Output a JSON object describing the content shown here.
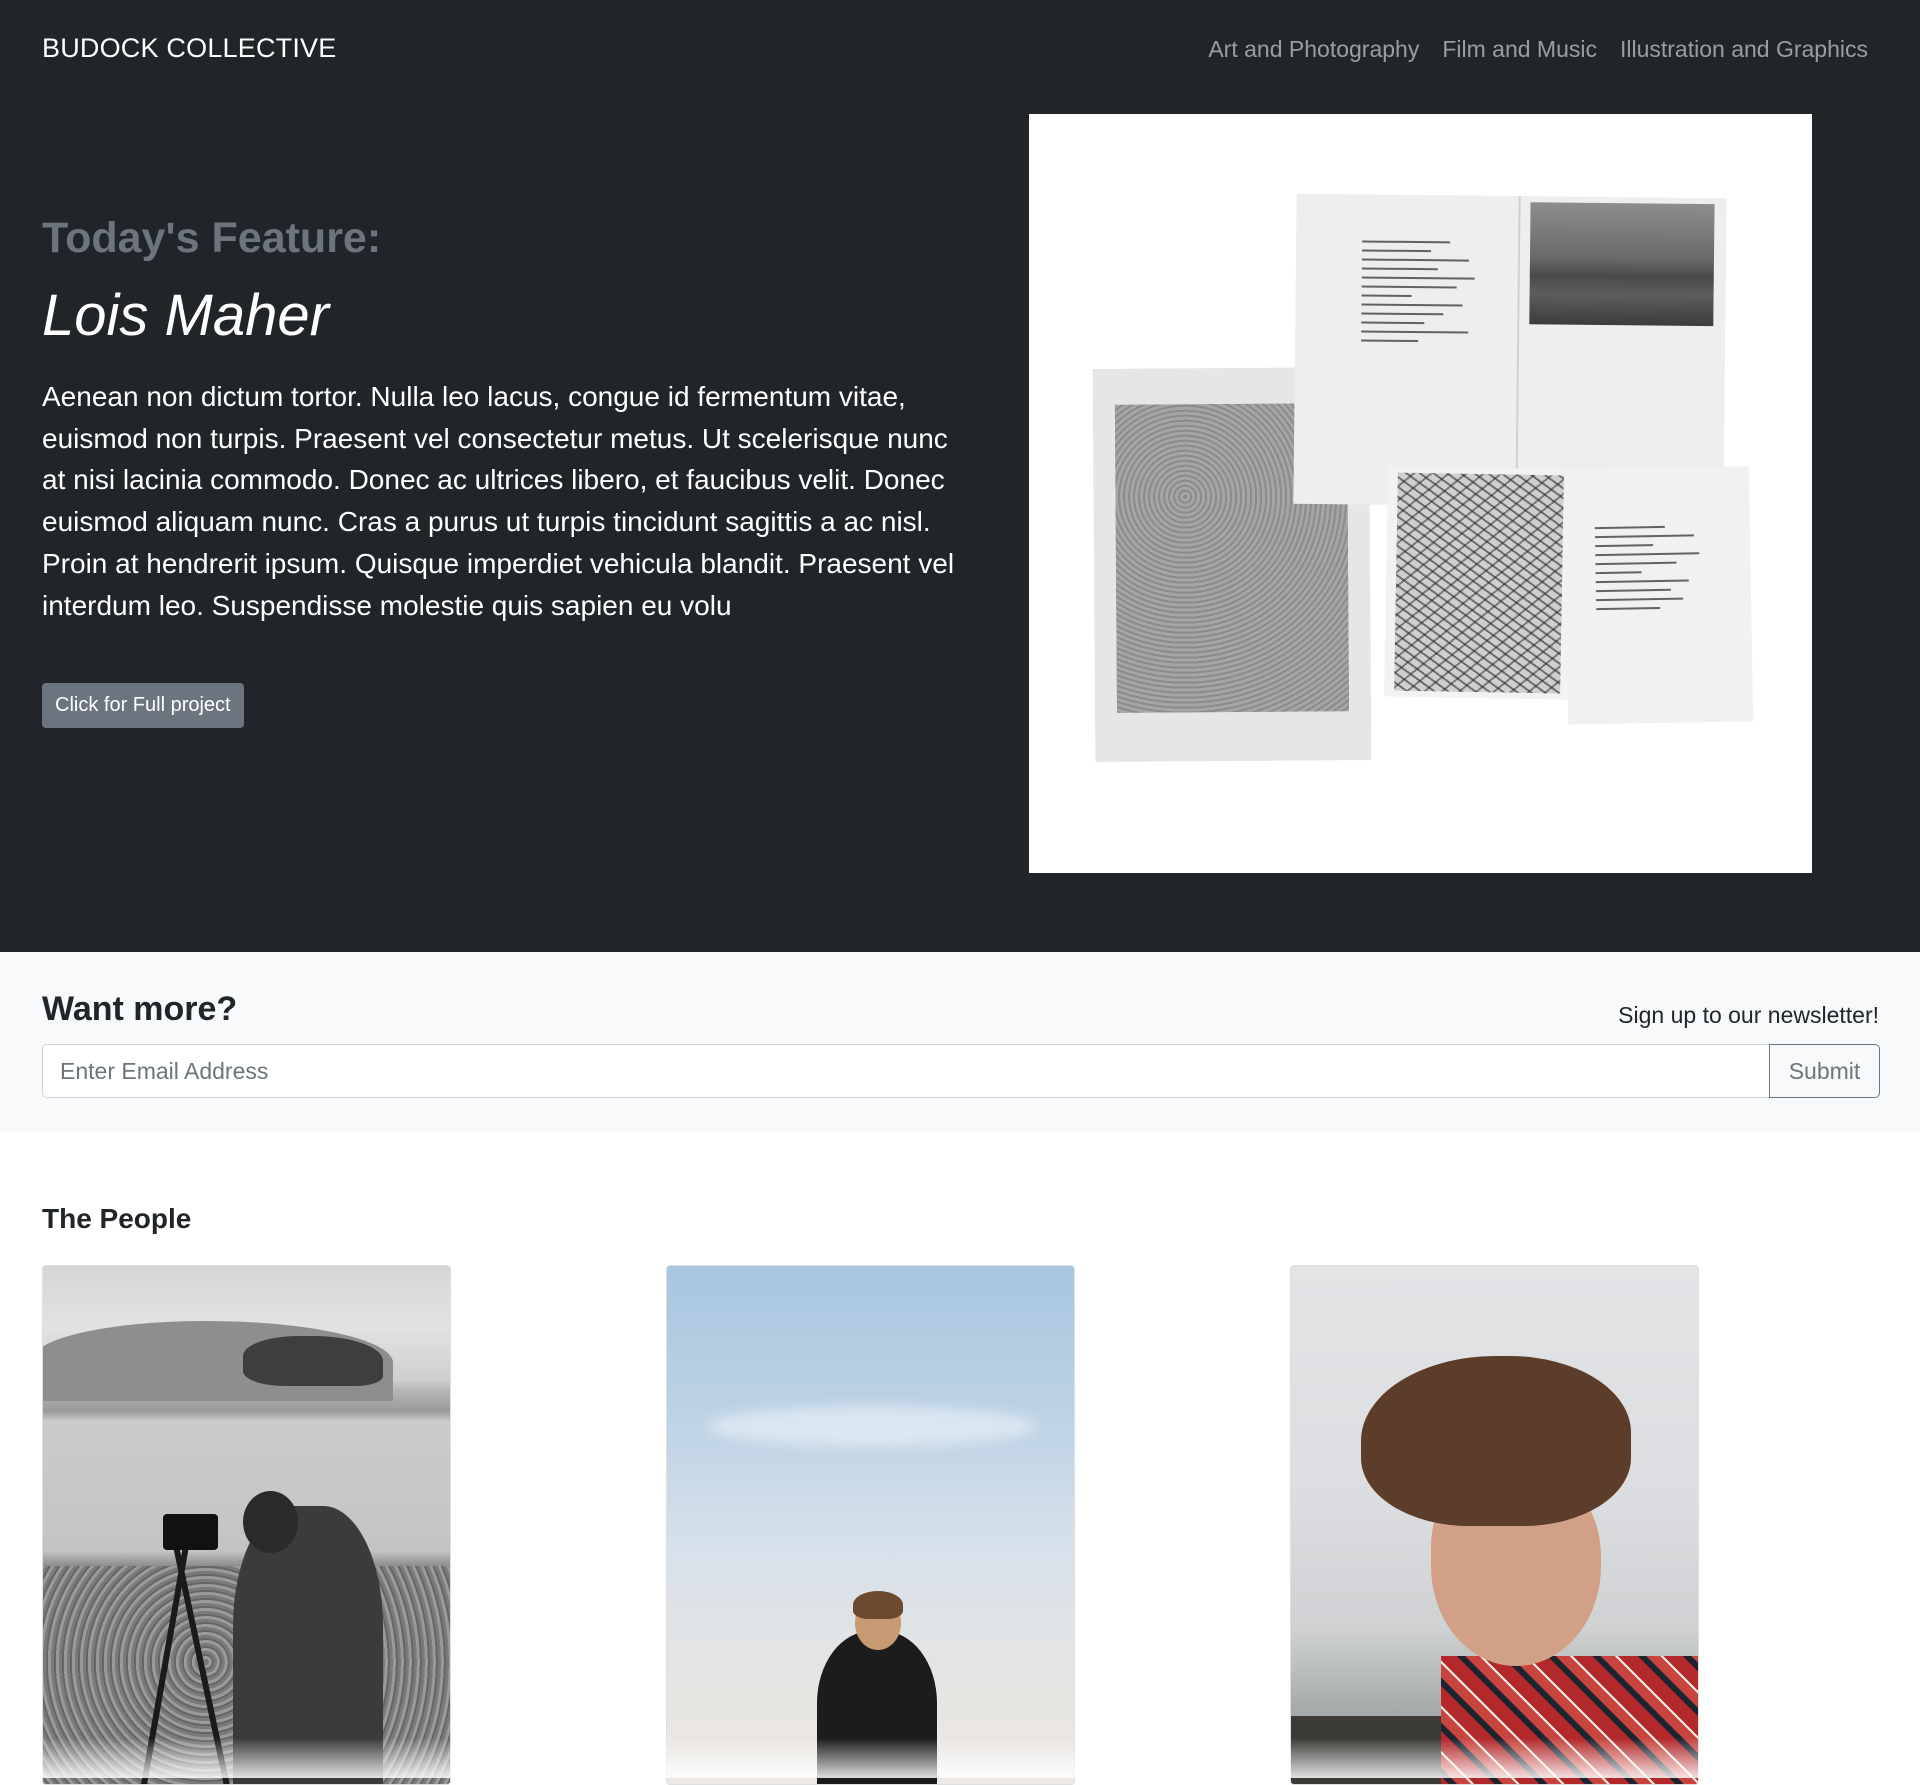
{
  "header": {
    "brand": "BUDOCK COLLECTIVE",
    "nav": [
      {
        "label": "Art and Photography"
      },
      {
        "label": "Film and Music"
      },
      {
        "label": "Illustration and Graphics"
      }
    ]
  },
  "feature": {
    "kicker": "Today's Feature:",
    "name": "Lois Maher",
    "body": "Aenean non dictum tortor. Nulla leo lacus, congue id fermentum vitae, euismod non turpis. Praesent vel consectetur metus. Ut scelerisque nunc at nisi lacinia commodo. Donec ac ultrices libero, et faucibus velit. Donec euismod aliquam nunc. Cras a purus ut turpis tincidunt sagittis a ac nisl. Proin at hendrerit ipsum. Quisque imperdiet vehicula blandit. Praesent vel interdum leo. Suspendisse molestie quis sapien eu volu",
    "button_label": "Click for Full project"
  },
  "newsletter": {
    "title": "Want more?",
    "subtitle": "Sign up to our newsletter!",
    "placeholder": "Enter Email Address",
    "submit_label": "Submit"
  },
  "people": {
    "title": "The People"
  },
  "colors": {
    "hero_bg": "#212529",
    "muted": "#6c757d",
    "light_bg": "#f8f9fa"
  }
}
